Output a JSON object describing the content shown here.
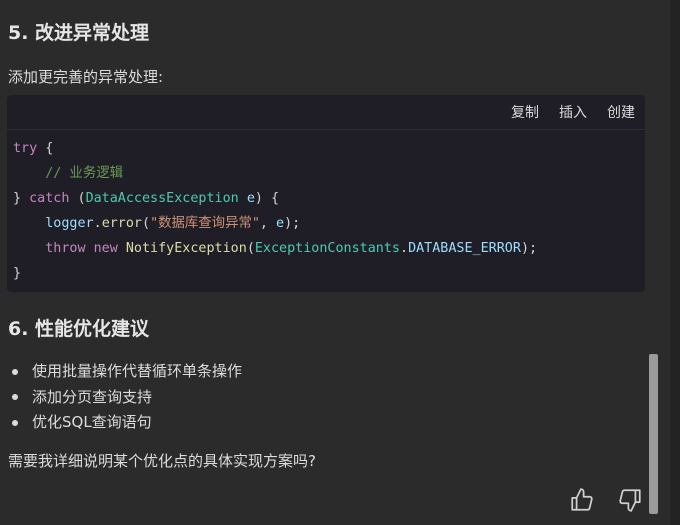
{
  "sections": {
    "heading5": "5. 改进异常处理",
    "intro5": "添加更完善的异常处理:",
    "heading6": "6. 性能优化建议",
    "closing": "需要我详细说明某个优化点的具体实现方案吗?"
  },
  "code_toolbar": {
    "copy_label": "复制",
    "insert_label": "插入",
    "create_label": "创建"
  },
  "code": {
    "try_kw": "try",
    "open_brace": " {",
    "comment": "// 业务逻辑",
    "close_brace": "}",
    "catch_kw": "catch",
    "exception_type": "DataAccessException",
    "var_e": "e",
    "logger": "logger",
    "error_fn": "error",
    "error_msg": "\"数据库查询异常\"",
    "throw_kw": "throw",
    "new_kw": "new",
    "notify_exception": "NotifyException",
    "constants_class": "ExceptionConstants",
    "constant_name": "DATABASE_ERROR"
  },
  "suggestions": [
    "使用批量操作代替循环单条操作",
    "添加分页查询支持",
    "优化SQL查询语句"
  ],
  "icons": {
    "like": "thumbs-up-icon",
    "dislike": "thumbs-down-icon"
  }
}
